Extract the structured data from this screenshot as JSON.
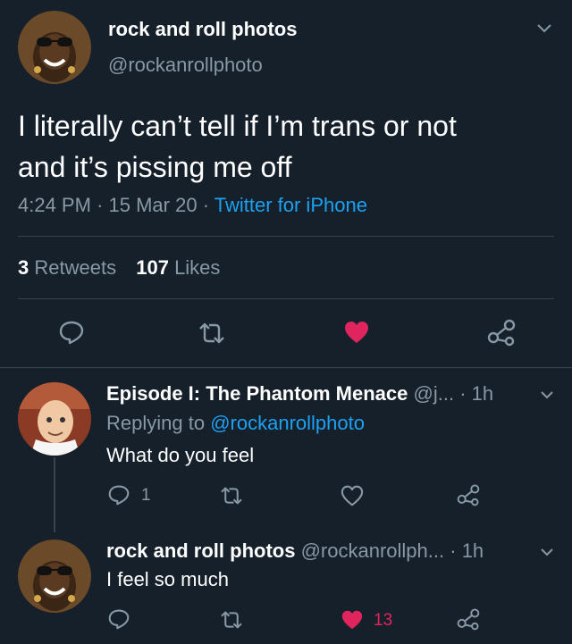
{
  "main_tweet": {
    "author_name": "rock and roll photos",
    "author_handle": "@rockanrollphoto",
    "text_line1": "I literally can’t tell if I’m trans or not",
    "text_line2": "and it’s pissing me off",
    "time": "4:24 PM",
    "date": "15 Mar 20",
    "source": "Twitter for iPhone",
    "retweet_count": "3",
    "retweet_label": "Retweets",
    "like_count": "107",
    "like_label": "Likes",
    "liked": true
  },
  "replies": [
    {
      "author_name": "Episode I: The Phantom Menace",
      "author_handle": "@j...",
      "time": "1h",
      "replying_prefix": "Replying to",
      "replying_handle": "@rockanrollphoto",
      "text": "What do you feel",
      "reply_count": "1",
      "like_count": "",
      "liked": false
    },
    {
      "author_name": "rock and roll photos",
      "author_handle": "@rockanrollph...",
      "time": "1h",
      "text": "I feel so much",
      "reply_count": "",
      "like_count": "13",
      "liked": true
    }
  ],
  "colors": {
    "background": "#15202b",
    "muted": "#8899a6",
    "accent": "#1da1f2",
    "like": "#e0245e",
    "divider": "#38444d"
  },
  "icons": [
    "reply-icon",
    "retweet-icon",
    "like-icon",
    "share-icon",
    "chevron-down-icon"
  ]
}
